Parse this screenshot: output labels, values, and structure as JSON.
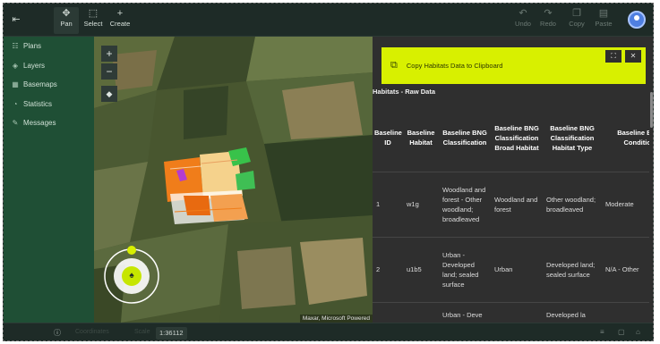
{
  "toolbar": {
    "left_icon": "exit-icon",
    "pan": {
      "label": "Pan",
      "icon": "move-icon"
    },
    "select": {
      "label": "Select",
      "icon": "select-box-icon"
    },
    "create": {
      "label": "Create",
      "icon": "plus-icon"
    },
    "undo": {
      "label": "Undo",
      "icon": "undo-icon"
    },
    "redo": {
      "label": "Redo",
      "icon": "redo-icon"
    },
    "copy": {
      "label": "Copy",
      "icon": "copy-icon"
    },
    "paste": {
      "label": "Paste",
      "icon": "paste-icon"
    },
    "avatar_color": "#4f7fe0"
  },
  "sidebar": {
    "items": [
      {
        "label": "Plans",
        "icon": "plans-icon"
      },
      {
        "label": "Layers",
        "icon": "layers-icon"
      },
      {
        "label": "Basemaps",
        "icon": "basemaps-icon"
      },
      {
        "label": "Statistics",
        "icon": "statistics-icon"
      },
      {
        "label": "Messages",
        "icon": "messages-icon"
      }
    ],
    "color": "#1f4f35"
  },
  "map": {
    "zoom_in": "+",
    "zoom_out": "−",
    "attribution": "Maxar, Microsoft  Powered",
    "accent": "#d8f000"
  },
  "panel": {
    "copy_banner": "Copy Habitats Data to Clipboard",
    "title": "Habitats - Raw Data",
    "columns": [
      "Baseline ID",
      "Baseline Habitat",
      "Baseline BNG Classification",
      "Baseline BNG Classification Broad Habitat",
      "Baseline BNG Classification Habitat Type",
      "Baseline BNG Condition"
    ],
    "rows": [
      [
        "1",
        "w1g",
        "Woodland and forest - Other woodland; broadleaved",
        "Woodland and forest",
        "Other woodland; broadleaved",
        "Moderate"
      ],
      [
        "2",
        "u1b5",
        "Urban - Developed land; sealed surface",
        "Urban",
        "Developed land; sealed surface",
        "N/A - Other"
      ],
      [
        "",
        "",
        "Urban - Deve",
        "",
        "Developed la",
        ""
      ]
    ]
  },
  "status": {
    "info_icon": "info-icon",
    "faint_1": "Coordinates",
    "faint_2": "Scale",
    "scale": "1:36112",
    "right_icons": [
      "filter-icon",
      "grid-icon",
      "lock-icon"
    ]
  }
}
